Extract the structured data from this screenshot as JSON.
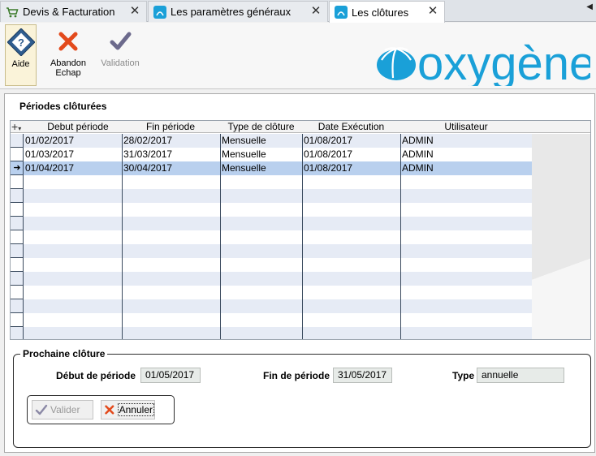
{
  "tabs": [
    {
      "label": "Devis & Facturation",
      "active": false
    },
    {
      "label": "Les paramètres généraux",
      "active": false
    },
    {
      "label": "Les clôtures",
      "active": true
    }
  ],
  "toolbar": {
    "aide_label": "Aide",
    "abandon_label": "Abandon",
    "abandon_sub": "Echap",
    "validation_label": "Validation"
  },
  "logo_text": "oxygène",
  "periods": {
    "title": "Périodes clôturées",
    "columns": [
      "Debut période",
      "Fin période",
      "Type de clôture",
      "Date Exécution",
      "Utilisateur"
    ],
    "rows": [
      {
        "debut": "01/02/2017",
        "fin": "28/02/2017",
        "type": "Mensuelle",
        "execution": "01/08/2017",
        "user": "ADMIN"
      },
      {
        "debut": "01/03/2017",
        "fin": "31/03/2017",
        "type": "Mensuelle",
        "execution": "01/08/2017",
        "user": "ADMIN"
      },
      {
        "debut": "01/04/2017",
        "fin": "30/04/2017",
        "type": "Mensuelle",
        "execution": "01/08/2017",
        "user": "ADMIN"
      }
    ],
    "selected_row": 2
  },
  "next": {
    "legend": "Prochaine clôture",
    "debut_label": "Début de période",
    "debut_value": "01/05/2017",
    "fin_label": "Fin de période",
    "fin_value": "31/05/2017",
    "type_label": "Type",
    "type_value": "annuelle",
    "valider_label": "Valider",
    "annuler_label": "Annuler"
  },
  "colors": {
    "brand": "#1aa0d8",
    "selected_row": "#b9d0ee",
    "alt_row": "#e6ebf5"
  }
}
